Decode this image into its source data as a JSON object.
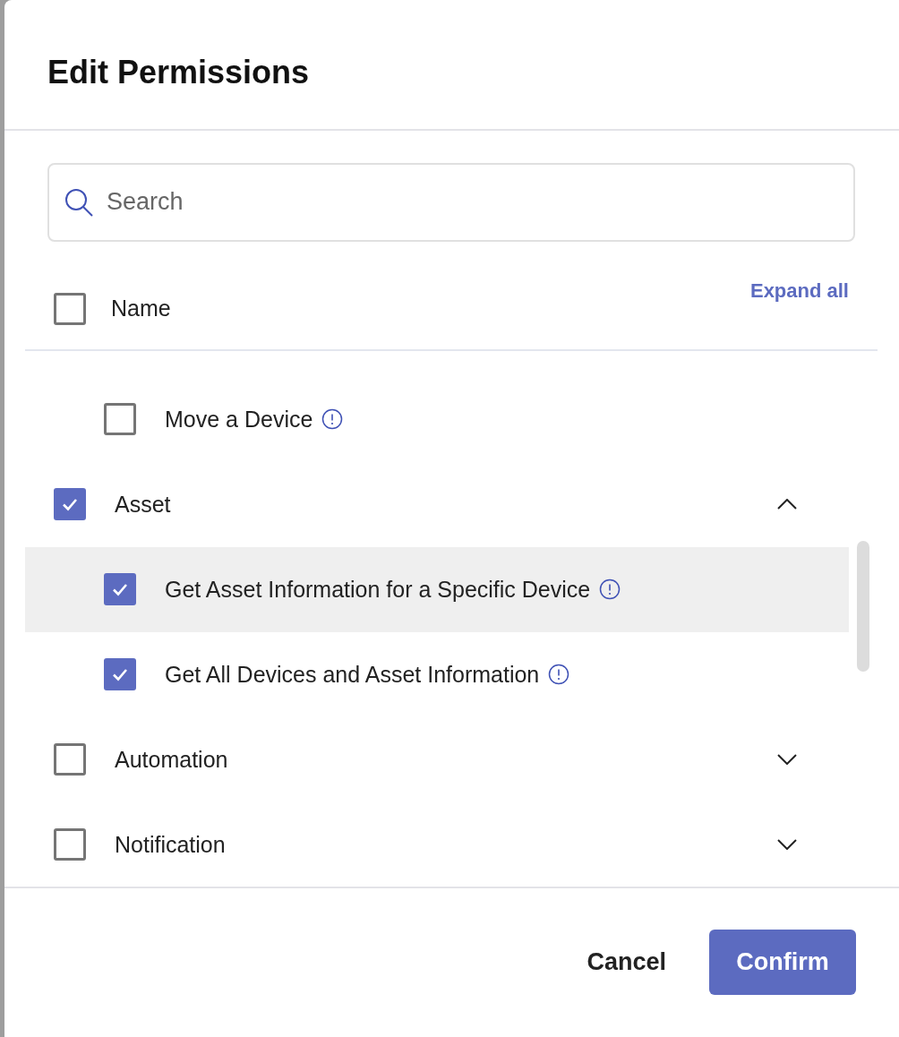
{
  "dialog": {
    "title": "Edit Permissions"
  },
  "search": {
    "placeholder": "Search"
  },
  "header": {
    "label": "Name",
    "checked": false,
    "expand_all": "Expand all"
  },
  "rows": [
    {
      "kind": "permission",
      "label": "Move a Device",
      "checked": false,
      "highlighted": false
    },
    {
      "kind": "group",
      "label": "Asset",
      "checked": true,
      "expanded": true,
      "children": [
        {
          "kind": "permission",
          "label": "Get Asset Information for a Specific Device",
          "checked": true,
          "highlighted": true
        },
        {
          "kind": "permission",
          "label": "Get All Devices and Asset Information",
          "checked": true,
          "highlighted": false
        }
      ]
    },
    {
      "kind": "group",
      "label": "Automation",
      "checked": false,
      "expanded": false,
      "children": []
    },
    {
      "kind": "group",
      "label": "Notification",
      "checked": false,
      "expanded": false,
      "children": []
    }
  ],
  "buttons": {
    "cancel": "Cancel",
    "confirm": "Confirm"
  }
}
